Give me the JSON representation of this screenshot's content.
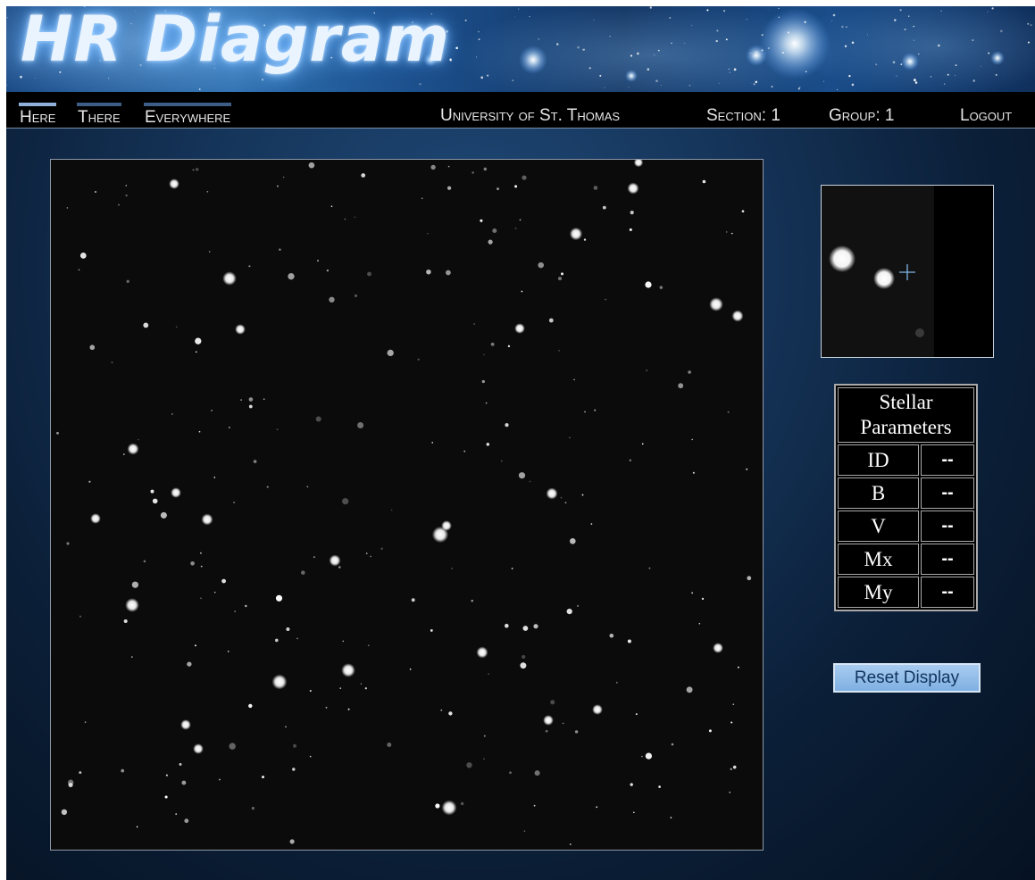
{
  "app": {
    "title": "HR Diagram"
  },
  "nav": {
    "tabs": [
      {
        "label": "Here",
        "active": true
      },
      {
        "label": "There",
        "active": false
      },
      {
        "label": "Everywhere",
        "active": false
      }
    ],
    "university": "University of St. Thomas",
    "section": "Section: 1",
    "group": "Group: 1",
    "logout": "Logout"
  },
  "params": {
    "title": "Stellar Parameters",
    "rows": [
      {
        "label": "ID",
        "value": "--"
      },
      {
        "label": "B",
        "value": "--"
      },
      {
        "label": "V",
        "value": "--"
      },
      {
        "label": "Mx",
        "value": "--"
      },
      {
        "label": "My",
        "value": "--"
      }
    ]
  },
  "reset_label": "Reset Display",
  "colors": {
    "nav_background": "#000000",
    "button": "#8fbbe8",
    "accent": "#3e5d86"
  }
}
